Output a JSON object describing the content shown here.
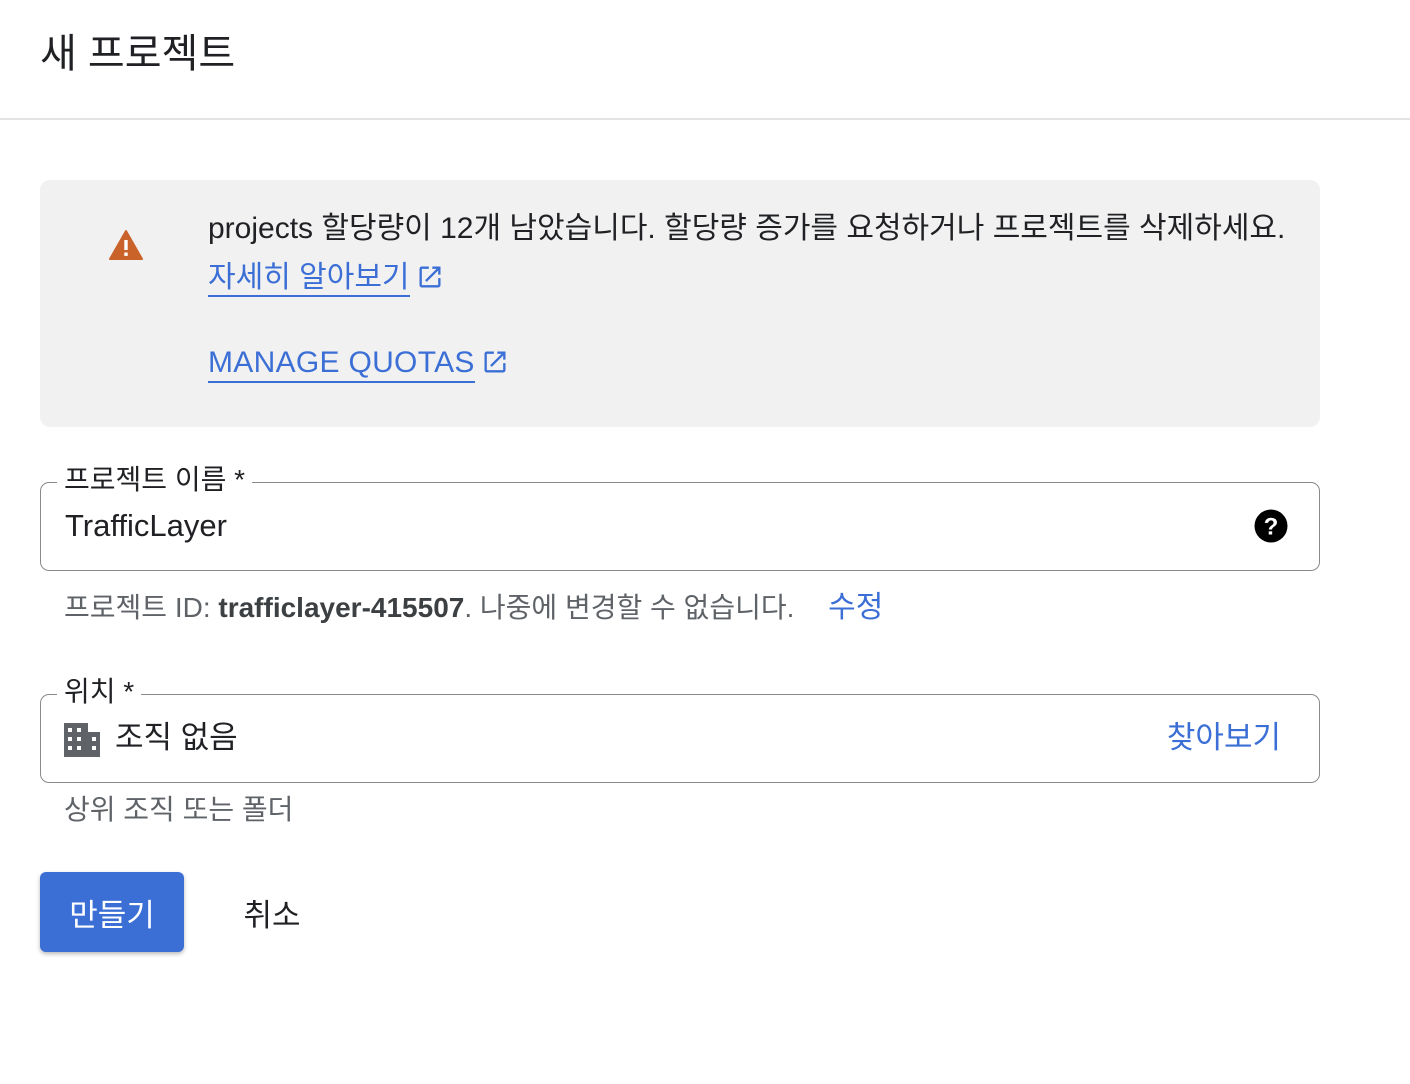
{
  "header": {
    "title": "새 프로젝트"
  },
  "alert": {
    "icon": "warning-icon",
    "icon_color": "#c9632a",
    "message": "projects 할당량이 12개 남았습니다. 할당량 증가를 요청하거나 프로젝트를 삭제하세요.",
    "learn_more_label": "자세히 알아보기",
    "manage_quotas_label": "MANAGE QUOTAS"
  },
  "project_name": {
    "label": "프로젝트 이름 *",
    "value": "TrafficLayer",
    "help_icon": "help-circle-icon"
  },
  "project_id": {
    "prefix": "프로젝트 ID: ",
    "id": "trafficlayer-415507",
    "suffix": ". 나중에 변경할 수 없습니다.",
    "edit_label": "수정"
  },
  "location": {
    "label": "위치 *",
    "icon": "building-icon",
    "value": "조직 없음",
    "browse_label": "찾아보기",
    "hint": "상위 조직 또는 폴더"
  },
  "actions": {
    "create_label": "만들기",
    "cancel_label": "취소"
  },
  "colors": {
    "accent": "#3b6fd6",
    "alert_background": "#f1f1f1",
    "warning": "#c9632a"
  }
}
